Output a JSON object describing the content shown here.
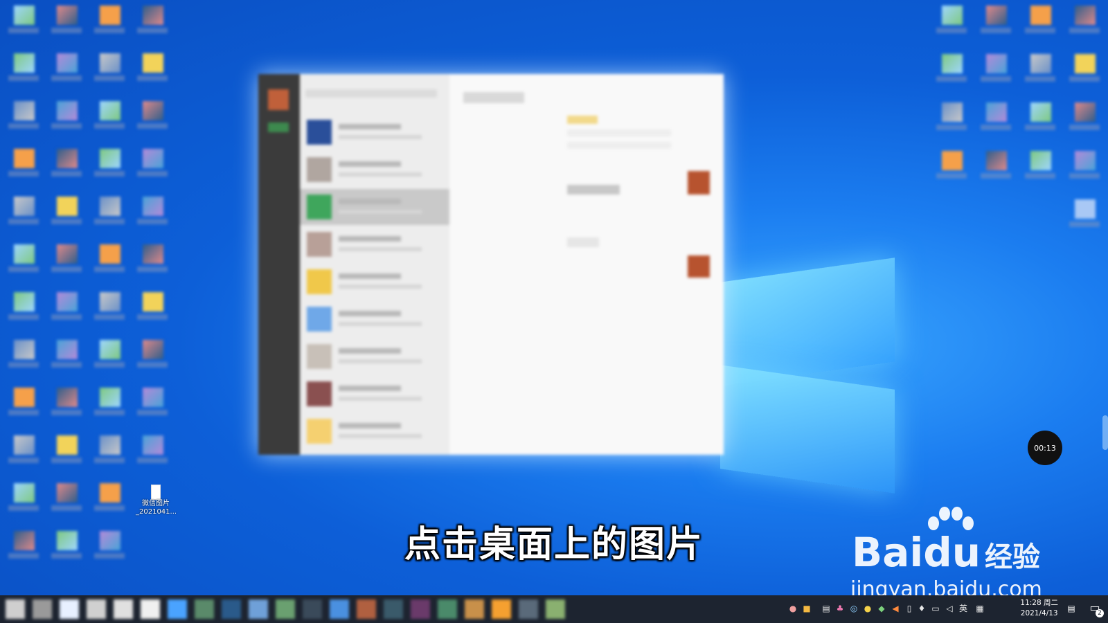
{
  "desktop": {
    "special_icon": {
      "line1": "微信图片",
      "line2": "_2021041..."
    }
  },
  "subtitle": "点击桌面上的图片",
  "recording": {
    "timer": "00:13"
  },
  "watermark": {
    "logo_bai": "Bai",
    "logo_du": "du",
    "logo_suffix": "经验",
    "url": "jingyan.baidu.com"
  },
  "taskbar": {
    "ime_lang": "英",
    "clock": {
      "time": "11:28 周二",
      "date": "2021/4/13"
    },
    "notification_count": "2"
  },
  "colors": {
    "desktop_bg": "#0d5fd8",
    "taskbar": "#1d2430",
    "accent": "#2a8cff"
  }
}
